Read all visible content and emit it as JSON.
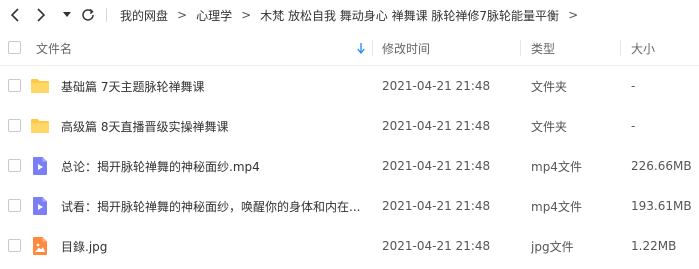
{
  "nav": {
    "breadcrumb": [
      "我的网盘",
      "心理学",
      "木梵 放松自我 舞动身心 禅舞课 脉轮禅修7脉轮能量平衡"
    ],
    "breadcrumb_sep": ">"
  },
  "header": {
    "name": "文件名",
    "modified": "修改时间",
    "type": "类型",
    "size": "大小"
  },
  "rows": [
    {
      "name": "基础篇 7天主题脉轮禅舞课",
      "date": "2021-04-21 21:48",
      "type": "文件夹",
      "size": "-",
      "icon": "folder-icon"
    },
    {
      "name": "高级篇 8天直播晋级实操禅舞课",
      "date": "2021-04-21 21:48",
      "type": "文件夹",
      "size": "-",
      "icon": "folder-icon"
    },
    {
      "name": "总论：揭开脉轮禅舞的神秘面纱.mp4",
      "date": "2021-04-21 21:48",
      "type": "mp4文件",
      "size": "226.66MB",
      "icon": "video-file-icon"
    },
    {
      "name": "试看：揭开脉轮禅舞的神秘面纱，唤醒你的身体和内在...",
      "date": "2021-04-21 21:48",
      "type": "mp4文件",
      "size": "193.61MB",
      "icon": "video-file-icon"
    },
    {
      "name": "目錄.jpg",
      "date": "2021-04-21 21:48",
      "type": "jpg文件",
      "size": "1.22MB",
      "icon": "image-file-icon"
    }
  ],
  "colors": {
    "folder": "#FFCB45",
    "video": "#7B7FF5",
    "image": "#FF8A3D",
    "sort_arrow": "#2F8CFF"
  }
}
